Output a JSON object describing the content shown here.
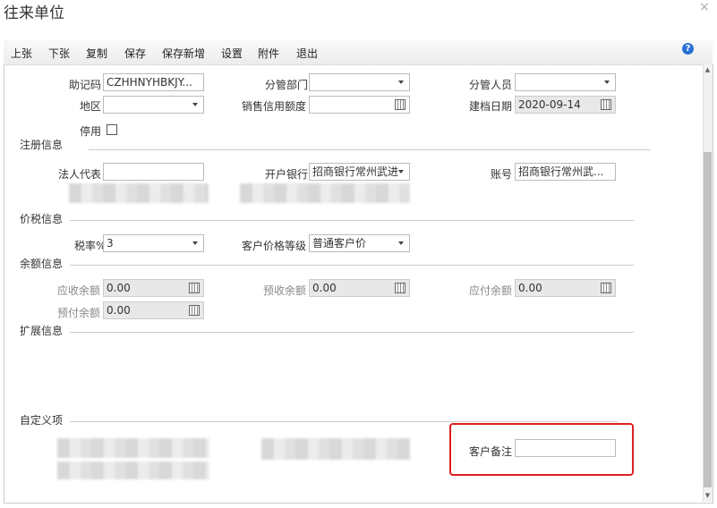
{
  "window": {
    "title": "往来单位",
    "close": "×"
  },
  "toolbar": {
    "items": [
      "上张",
      "下张",
      "复制",
      "保存",
      "保存新增",
      "设置",
      "附件",
      "退出"
    ],
    "help": "?"
  },
  "form": {
    "mnemonic_label": "助记码",
    "mnemonic_value": "CZHHNYHBKJY...",
    "dept_label": "分管部门",
    "dept_value": "",
    "staff_label": "分管人员",
    "staff_value": "",
    "region_label": "地区",
    "region_value": "",
    "credit_label": "销售信用额度",
    "credit_value": "",
    "created_label": "建档日期",
    "created_value": "2020-09-14",
    "disabled_label": "停用"
  },
  "registration": {
    "section": "注册信息",
    "legal_label": "法人代表",
    "legal_value": "",
    "bank_label": "开户银行",
    "bank_value": "招商银行常州武进",
    "account_label": "账号",
    "account_value": "招商银行常州武..."
  },
  "tax": {
    "section": "价税信息",
    "rate_label": "税率%",
    "rate_value": "3",
    "price_label": "客户价格等级",
    "price_value": "普通客户价"
  },
  "balance": {
    "section": "余额信息",
    "receivable_label": "应收余额",
    "receivable_value": "0.00",
    "prereceived_label": "预收余额",
    "prereceived_value": "0.00",
    "payable_label": "应付余额",
    "payable_value": "0.00",
    "prepaid_label": "预付余额",
    "prepaid_value": "0.00"
  },
  "extended": {
    "section": "扩展信息"
  },
  "custom": {
    "section": "自定义项",
    "remark_label": "客户备注",
    "remark_value": ""
  },
  "colors": {
    "highlight": "#e02020",
    "help_icon": "#2a6fd6"
  }
}
